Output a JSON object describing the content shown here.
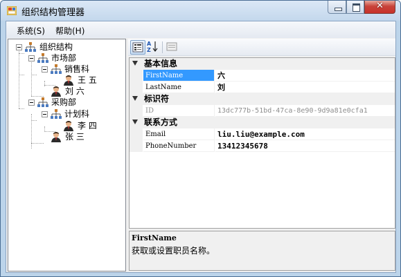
{
  "window": {
    "title": "组织结构管理器",
    "close_glyph": "✕"
  },
  "menu": {
    "items": [
      "系统(S)",
      "帮助(H)"
    ]
  },
  "tree": {
    "root": "组织结构",
    "dept1": "市场部",
    "dept1_section": "销售科",
    "dept1_section_person": "王 五",
    "dept1_person": "刘 六",
    "dept2": "采购部",
    "dept2_section": "计划科",
    "dept2_section_person": "李 四",
    "dept2_person": "张 三"
  },
  "toolbar": {
    "buttons": [
      "categorized-icon",
      "alphabetical-icon",
      "property-pages-icon"
    ]
  },
  "property_grid": {
    "categories": [
      {
        "label": "基本信息",
        "properties": [
          {
            "name": "FirstName",
            "value": "六"
          },
          {
            "name": "LastName",
            "value": "刘"
          }
        ]
      },
      {
        "label": "标识符",
        "properties": [
          {
            "name": "ID",
            "value": "13dc777b-51bd-47ca-8e90-9d9a81e0cfa1"
          }
        ]
      },
      {
        "label": "联系方式",
        "properties": [
          {
            "name": "Email",
            "value": "liu.liu@example.com"
          },
          {
            "name": "PhoneNumber",
            "value": "13412345678"
          }
        ]
      }
    ]
  },
  "help": {
    "title": "FirstName",
    "description": "获取或设置职员名称。"
  },
  "colors": {
    "selection": "#3399ff",
    "readonly_text": "#8d8d8d",
    "titlebar": "#c3d7ec",
    "close_button": "#c8433a"
  }
}
